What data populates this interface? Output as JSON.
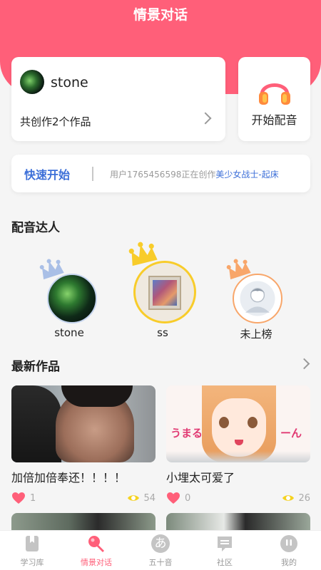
{
  "header": {
    "title": "情景对话"
  },
  "profile": {
    "username": "stone",
    "works_count_text": "共创作2个作品"
  },
  "dub_button": {
    "label": "开始配音",
    "icon": "headphones-icon"
  },
  "quick_start": {
    "label": "快速开始",
    "status_prefix": "用户1765456598正在创作",
    "status_highlight": "美少女战士-起床"
  },
  "rankings": {
    "title": "配音达人",
    "items": [
      {
        "rank": 2,
        "name": "stone",
        "crown_color": "#a9bfe6"
      },
      {
        "rank": 1,
        "name": "ss",
        "crown_color": "#f8cc2a"
      },
      {
        "rank": 3,
        "name": "未上榜",
        "crown_color": "#f8a66a"
      }
    ]
  },
  "latest_works": {
    "title": "最新作品",
    "items": [
      {
        "title": "加倍加倍奉还！！！！",
        "likes": "1",
        "views": "54"
      },
      {
        "title": "小埋太可爱了",
        "likes": "0",
        "views": "26",
        "thumb_text_left": "うまる",
        "thumb_text_right": "ーん"
      }
    ]
  },
  "tabbar": {
    "items": [
      {
        "label": "学习库",
        "icon": "bookmark-icon",
        "active": false
      },
      {
        "label": "情景对话",
        "icon": "microphone-icon",
        "active": true
      },
      {
        "label": "五十音",
        "icon": "hiragana-a-icon",
        "glyph": "あ",
        "active": false
      },
      {
        "label": "社区",
        "icon": "chat-icon",
        "active": false
      },
      {
        "label": "我的",
        "icon": "profile-icon",
        "active": false
      }
    ]
  },
  "colors": {
    "brand": "#ff5f79",
    "link_blue": "#3c6fd8",
    "eye_yellow": "#f5d21f"
  }
}
